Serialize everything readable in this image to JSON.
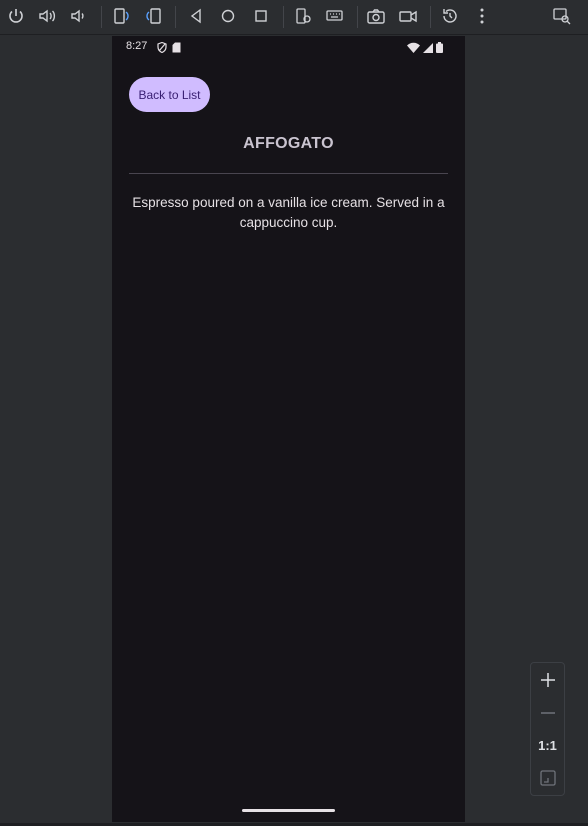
{
  "status_bar": {
    "time": "8:27"
  },
  "screen": {
    "back_button": "Back to List",
    "title": "AFFOGATO",
    "description": "Espresso poured on a vanilla ice cream. Served in a cappuccino cup."
  },
  "zoom": {
    "one_to_one": "1:1"
  },
  "colors": {
    "accent": "#d0bcff",
    "screen_bg": "#151318",
    "chrome_bg": "#2b2d30"
  }
}
